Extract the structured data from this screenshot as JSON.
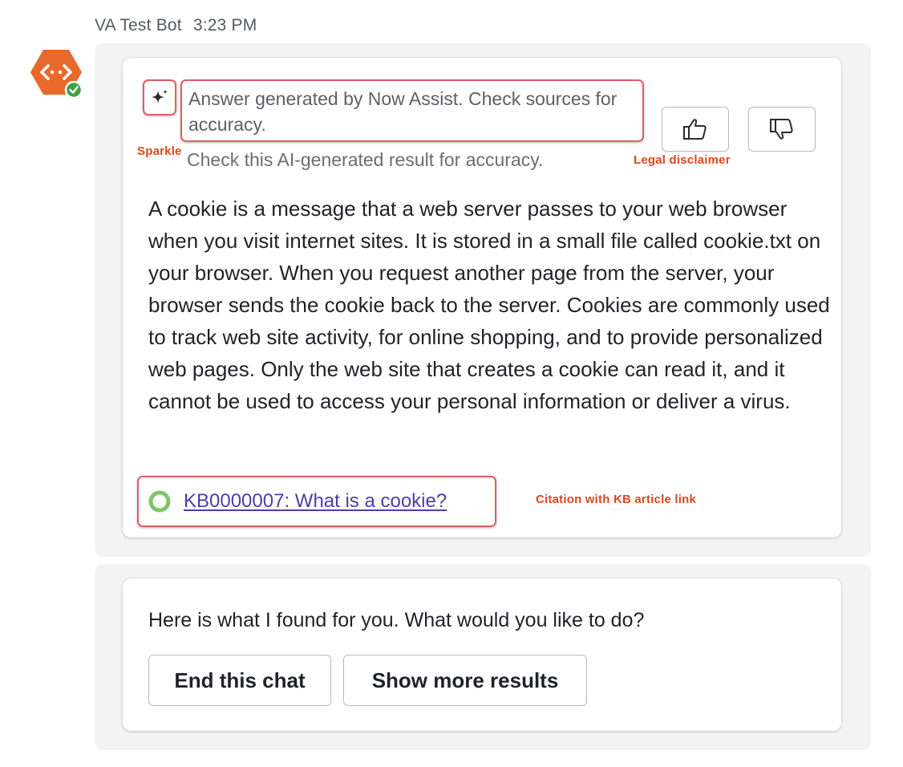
{
  "header": {
    "bot_name": "VA Test Bot",
    "time": "3:23 PM"
  },
  "colors": {
    "avatar_orange": "#e8692a",
    "status_green": "#3ea040",
    "annotation_red": "#e05c64",
    "link_purple": "#4b3ea8"
  },
  "answer_card": {
    "sparkle_icon": "sparkle-icon",
    "ai_note": "Answer generated by Now Assist. Check sources for accuracy.",
    "sub_note": "Check this AI-generated result for accuracy.",
    "thumbs_up_icon": "thumbs-up-icon",
    "thumbs_down_icon": "thumbs-down-icon",
    "answer_text": "A cookie is a message that a web server passes to your web browser when you visit internet sites. It is stored in a small file called cookie.txt on your browser. When you request another page from the server, your browser sends the cookie back to the server. Cookies are commonly used to track web site activity, for online shopping, and to provide personalized web pages. Only the web site that creates a cookie can read it, and it cannot be used to access your personal information or deliver a virus.",
    "citation": "KB0000007: What is a cookie?"
  },
  "annotations": {
    "sparkle": "Sparkle",
    "legal": "Legal disclaimer",
    "citation": "Citation with KB article link"
  },
  "followup_card": {
    "prompt": "Here is what I found for you. What would you like to do?",
    "buttons": [
      "End this chat",
      "Show more results"
    ]
  }
}
